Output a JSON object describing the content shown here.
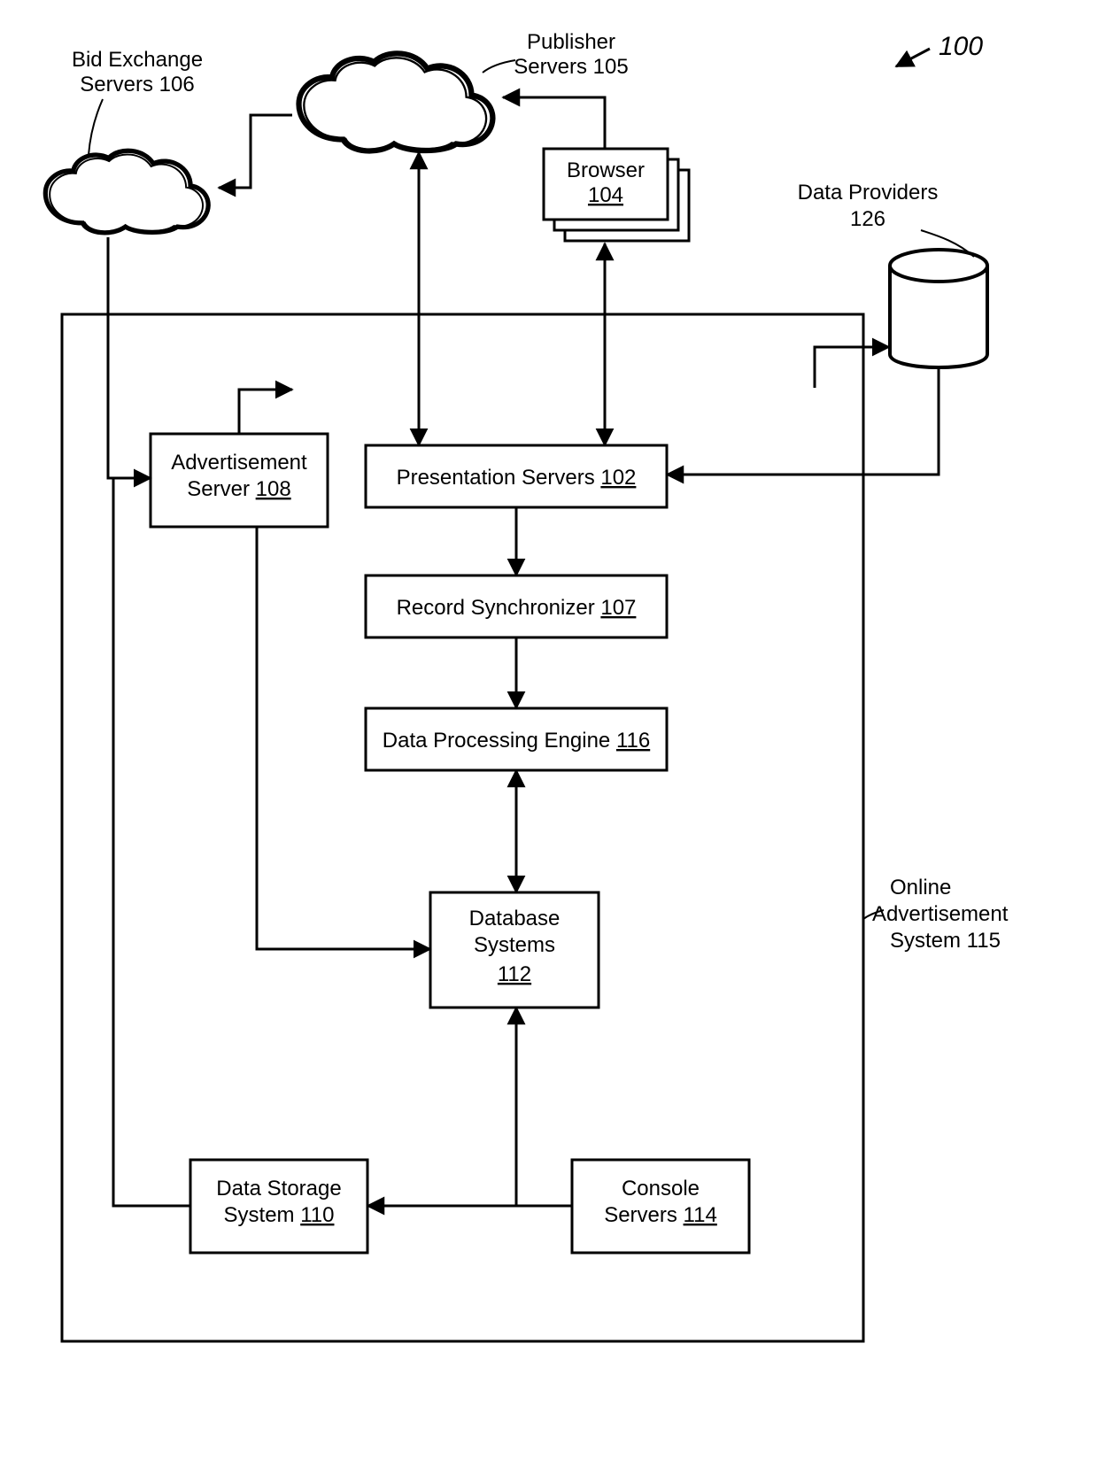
{
  "figure_ref": "100",
  "labels": {
    "bid_exchange": {
      "line1": "Bid Exchange",
      "line2": "Servers 106"
    },
    "publisher": {
      "line1": "Publisher",
      "line2": "Servers 105"
    },
    "browser": {
      "text": "Browser",
      "num": "104"
    },
    "data_providers": {
      "line1": "Data Providers",
      "line2": "126"
    },
    "ad_server": {
      "line1": "Advertisement",
      "line2": "Server ",
      "num": "108"
    },
    "presentation": {
      "text": "Presentation Servers ",
      "num": "102"
    },
    "record_sync": {
      "text": "Record Synchronizer ",
      "num": "107"
    },
    "dpe": {
      "text": "Data Processing Engine ",
      "num": "116"
    },
    "db": {
      "line1": "Database",
      "line2": "Systems",
      "num": "112"
    },
    "storage": {
      "line1": "Data Storage",
      "line2": "System ",
      "num": "110"
    },
    "console": {
      "line1": "Console",
      "line2": "Servers ",
      "num": "114"
    },
    "system_box": {
      "line1": "Online",
      "line2": "Advertisement",
      "line3": "System 115"
    }
  }
}
